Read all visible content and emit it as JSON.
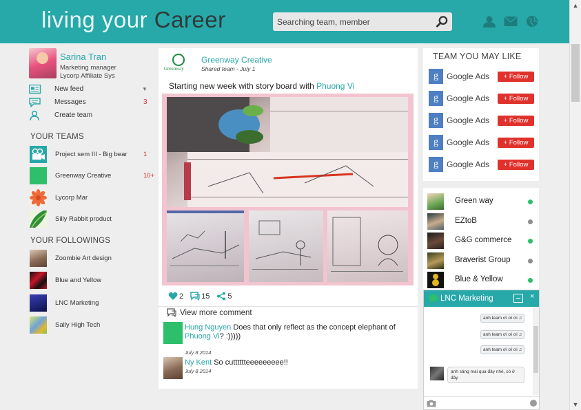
{
  "header": {
    "logo_light": "living your",
    "logo_dark": "Career",
    "search_placeholder": "Searching team, member"
  },
  "profile": {
    "name": "Sarina Tran",
    "role": "Marketing manager",
    "org": "Lycorp Affiliate Sys"
  },
  "nav": [
    {
      "label": "New feed",
      "count": ""
    },
    {
      "label": "Messages",
      "count": "3"
    },
    {
      "label": "Create team",
      "count": ""
    }
  ],
  "your_teams": {
    "title": "YOUR TEAMS",
    "items": [
      {
        "label": "Project sem III - Big bear",
        "count": "1"
      },
      {
        "label": "Greenway Creative",
        "count": "10+"
      },
      {
        "label": "Lycorp Mar",
        "count": ""
      },
      {
        "label": "Silly Rabbit product",
        "count": ""
      }
    ]
  },
  "your_followings": {
    "title": "YOUR FOLLOWINGS",
    "items": [
      {
        "label": "Zoombie Art design"
      },
      {
        "label": "Blue and Yellow"
      },
      {
        "label": "LNC Marketing"
      },
      {
        "label": "Sally High Tech"
      }
    ]
  },
  "post": {
    "logo_text": "Greenway",
    "team": "Greenway Creative",
    "subtitle": "Shared team - July 1",
    "text": "Starting new week with story board with ",
    "mention": "Phuong Vi",
    "likes": "2",
    "comments": "15",
    "shares": "5",
    "view_more": "View more comment",
    "comment_list": [
      {
        "who": "Hung Nguyen",
        "text": " Does that only reflect as the concept elephant of ",
        "mention": "Phuong Vi",
        "tail": "? :)))))",
        "date": "July 8 2014"
      },
      {
        "who": "Ny Kent",
        "text": " So cutttttteeeeeeeee!!",
        "mention": "",
        "tail": "",
        "date": "July 8 2014"
      }
    ]
  },
  "team_you_may_like": {
    "title": "TEAM YOU MAY LIKE",
    "follow_label": "Follow",
    "items": [
      {
        "name": "Google Ads",
        "icon": "g"
      },
      {
        "name": "Google Ads",
        "icon": "g"
      },
      {
        "name": "Google Ads",
        "icon": "g"
      },
      {
        "name": "Google Ads",
        "icon": "g"
      },
      {
        "name": "Google Ads",
        "icon": "g"
      }
    ]
  },
  "friends": [
    {
      "name": "Green way",
      "status_color": "#2dbf6a"
    },
    {
      "name": "EZtoB",
      "status_color": "#8d8d8d"
    },
    {
      "name": "G&G commerce",
      "status_color": "#2dbf6a"
    },
    {
      "name": "Braverist Group",
      "status_color": "#8d8d8d"
    },
    {
      "name": "Blue & Yellow",
      "status_color": "#2dbf6a"
    }
  ],
  "chat": {
    "title": "LNC Marketing",
    "close": "×",
    "messages_out": [
      "anh team ơi ơi ơi ♫",
      "anh team ơi ơi ơi ♫",
      "anh team ơi ơi ơi ♫"
    ],
    "message_in": "anh sáng mai qua đây nhé, có ở đây"
  },
  "colors": {
    "accent": "#27a8a9",
    "follow": "#e0312c",
    "count_red": "#d4322f"
  }
}
